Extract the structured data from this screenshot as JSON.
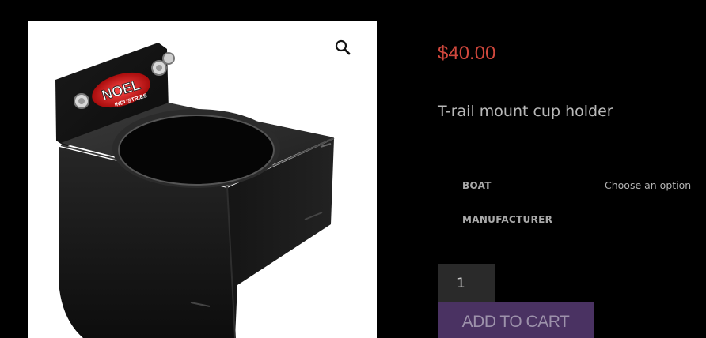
{
  "product": {
    "price": "$40.00",
    "title": "T-rail mount cup holder",
    "image_alt": "Black T-rail mount cup holder with Noel Industries logo",
    "logo_text": "NOEL",
    "logo_subtext": "INDUSTRIES"
  },
  "zoom": {
    "icon": "magnifier-icon"
  },
  "variations": [
    {
      "label": "BOAT",
      "value": "Choose an option"
    },
    {
      "label": "MANUFACTURER",
      "value": ""
    }
  ],
  "cart": {
    "quantity": "1",
    "add_label": "ADD TO CART"
  },
  "colors": {
    "background": "#000000",
    "price": "#d1483d",
    "button": "#4a3262"
  }
}
